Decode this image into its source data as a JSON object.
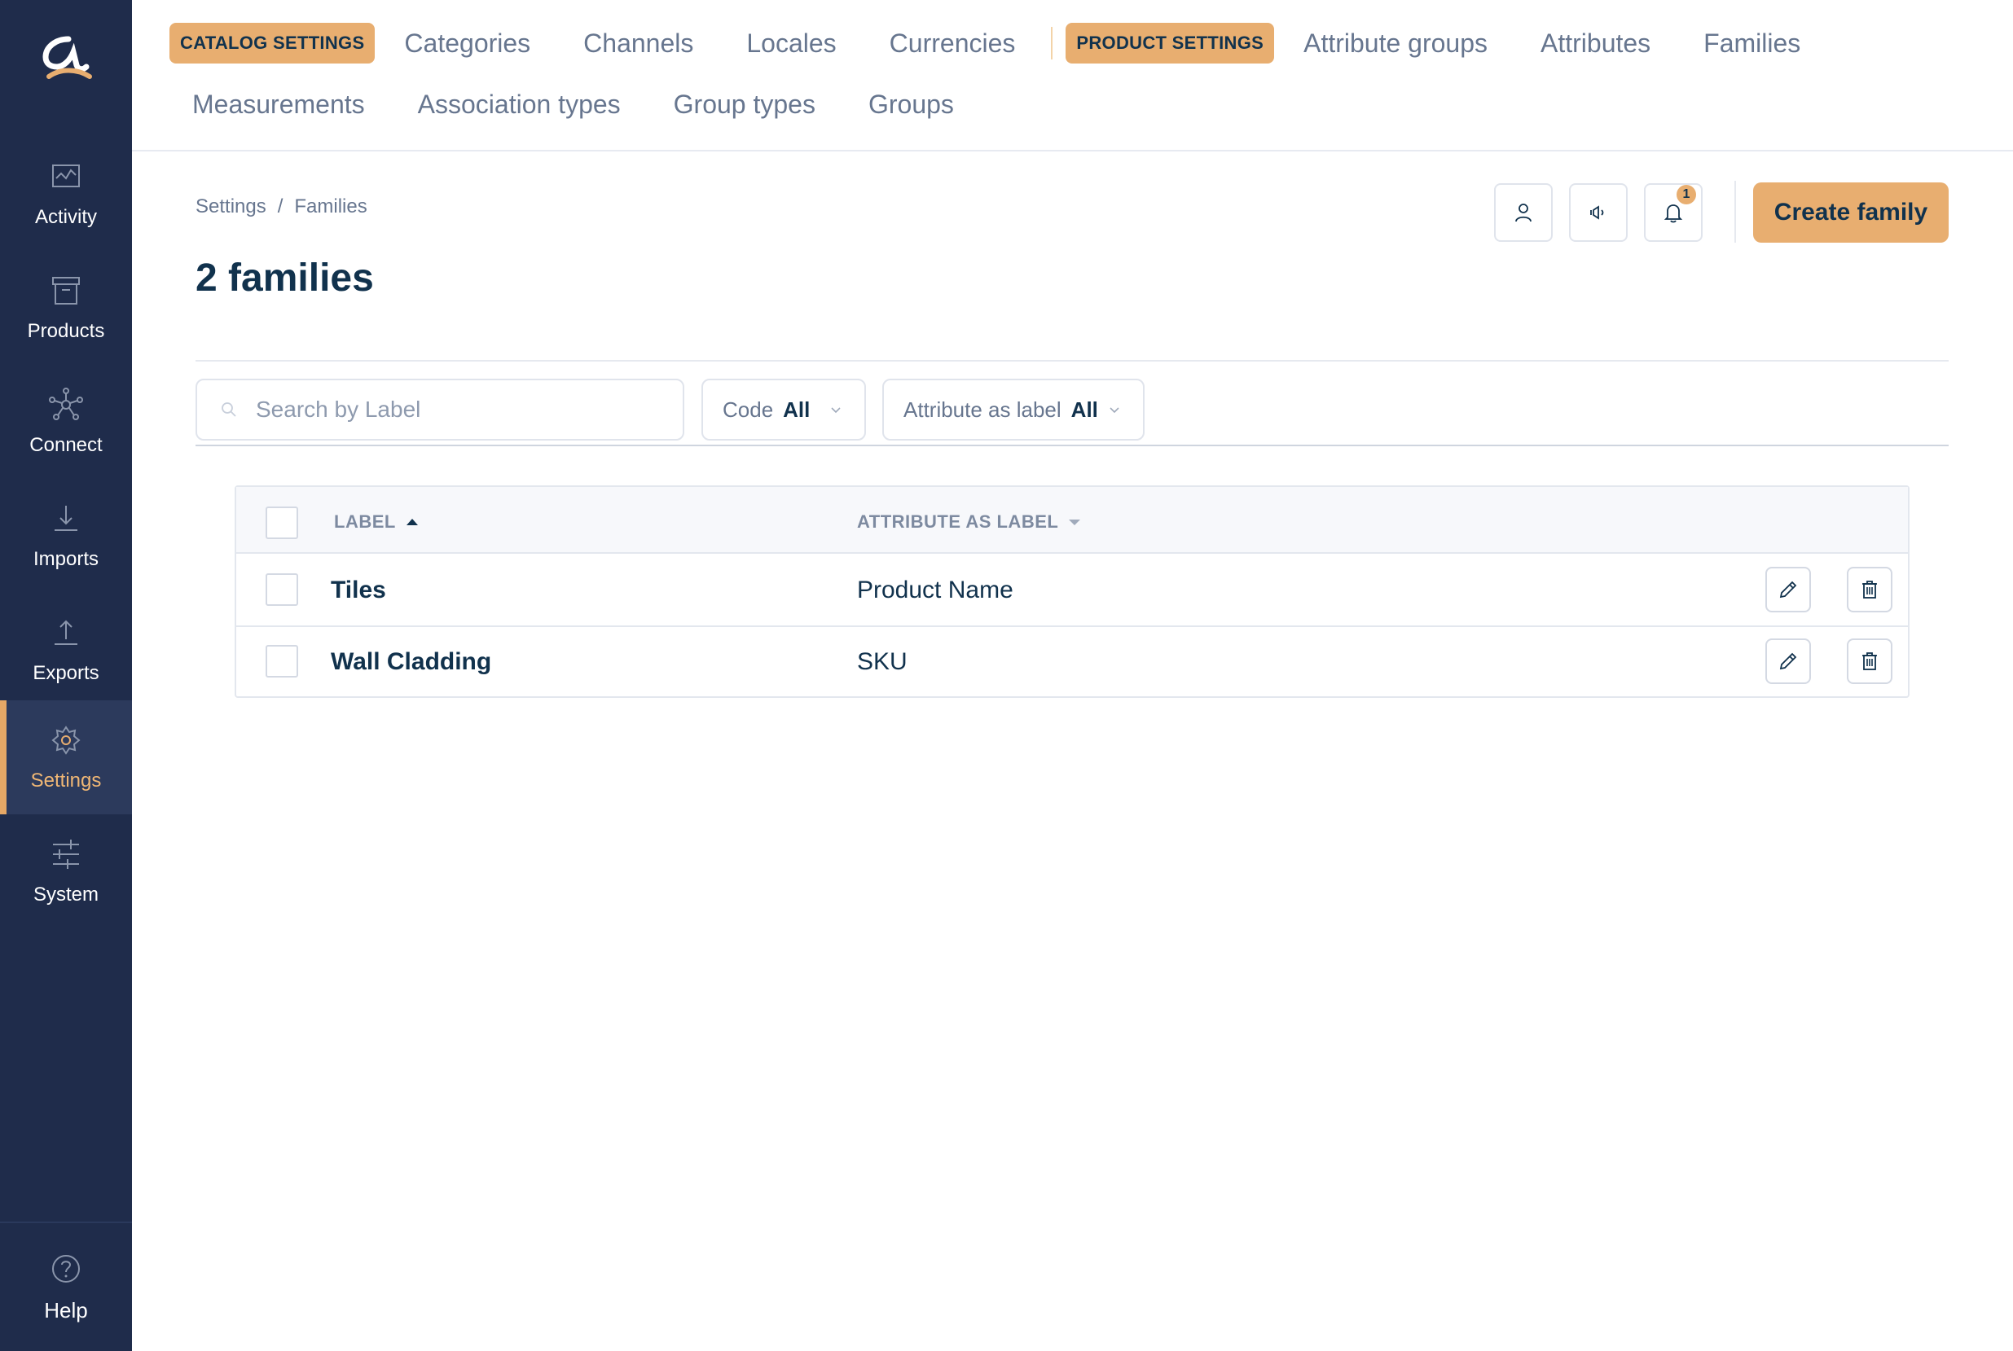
{
  "sidebar": {
    "items": [
      {
        "label": "Activity",
        "icon": "activity-icon"
      },
      {
        "label": "Products",
        "icon": "products-icon"
      },
      {
        "label": "Connect",
        "icon": "connect-icon"
      },
      {
        "label": "Imports",
        "icon": "imports-icon"
      },
      {
        "label": "Exports",
        "icon": "exports-icon"
      },
      {
        "label": "Settings",
        "icon": "settings-icon",
        "active": true
      },
      {
        "label": "System",
        "icon": "system-icon"
      }
    ],
    "help_label": "Help"
  },
  "topmenu": {
    "catalog_pill": "CATALOG SETTINGS",
    "catalog_links": [
      "Categories",
      "Channels",
      "Locales",
      "Currencies"
    ],
    "product_pill": "PRODUCT SETTINGS",
    "product_links": [
      "Attribute groups",
      "Attributes",
      "Families"
    ],
    "second_row_links": [
      "Measurements",
      "Association types",
      "Group types",
      "Groups"
    ]
  },
  "breadcrumb": {
    "root": "Settings",
    "separator": "/",
    "current": "Families"
  },
  "header": {
    "title": "2 families",
    "notification_count": "1",
    "create_button": "Create family"
  },
  "filters": {
    "search_placeholder": "Search by Label",
    "code_label": "Code",
    "code_value": "All",
    "attr_label": "Attribute as label",
    "attr_value": "All"
  },
  "table": {
    "columns": [
      "LABEL",
      "ATTRIBUTE AS LABEL"
    ],
    "sort": {
      "column": "LABEL",
      "direction": "ascending"
    },
    "rows": [
      {
        "label": "Tiles",
        "attribute_as_label": "Product Name"
      },
      {
        "label": "Wall Cladding",
        "attribute_as_label": "SKU"
      }
    ]
  },
  "colors": {
    "sidebar_bg": "#1f2c4b",
    "accent": "#e8ae70",
    "text_dark": "#11324d",
    "text_muted": "#67768f"
  }
}
